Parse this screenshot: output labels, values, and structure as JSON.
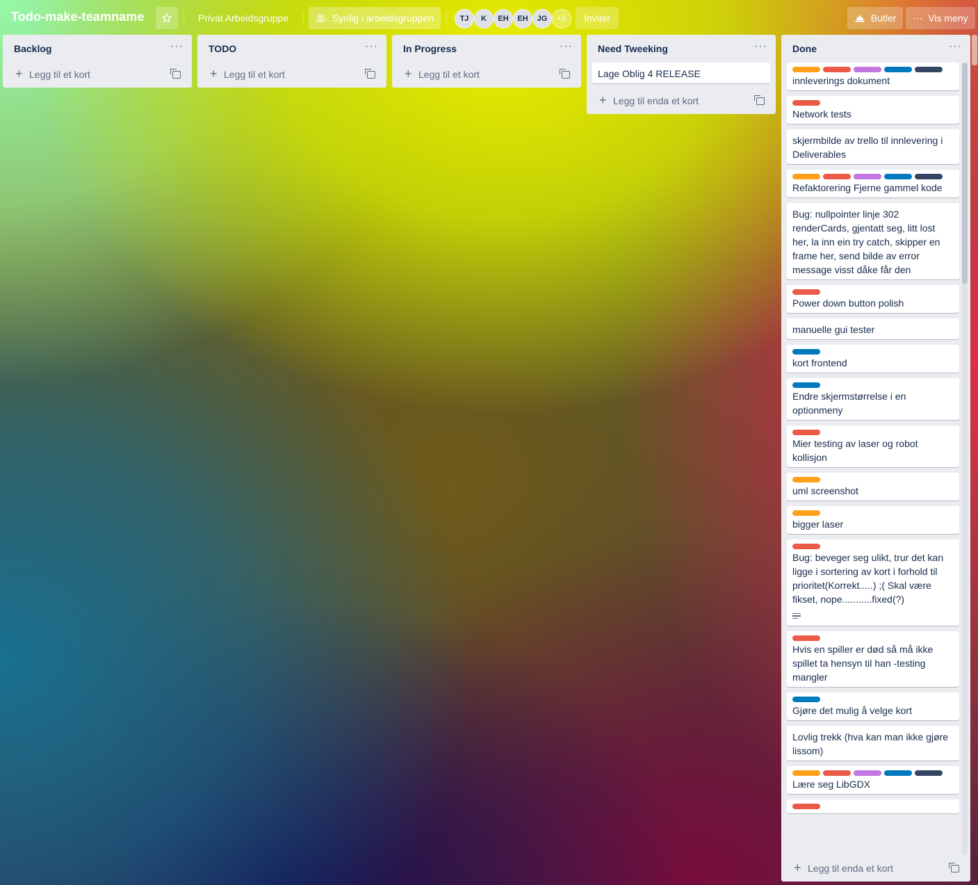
{
  "board": {
    "title": "Todo-make-teamname",
    "workspace": "Privat Arbeidsgruppe",
    "visibility": "Synlig i arbeidsgruppen",
    "members": [
      "TJ",
      "K",
      "EH",
      "EH",
      "JG"
    ],
    "more_members": "+2",
    "invite": "Inviter",
    "butler": "Butler",
    "show_menu": "Vis meny"
  },
  "lists": [
    {
      "title": "Backlog",
      "add_label": "Legg til et kort"
    },
    {
      "title": "TODO",
      "add_label": "Legg til et kort"
    },
    {
      "title": "In Progress",
      "add_label": "Legg til et kort"
    },
    {
      "title": "Need Tweeking",
      "add_label": "Legg til enda et kort",
      "cards": [
        {
          "text": "Lage Oblig 4 RELEASE"
        }
      ]
    },
    {
      "title": "Done",
      "add_label": "Legg til enda et kort",
      "cards": [
        {
          "labels": [
            "orange",
            "red",
            "purple",
            "blue",
            "navy"
          ],
          "text": "innleverings dokument"
        },
        {
          "labels": [
            "red"
          ],
          "text": "Network tests"
        },
        {
          "labels": [],
          "text": "skjermbilde av trello til innlevering i Deliverables"
        },
        {
          "labels": [
            "orange",
            "red",
            "purple",
            "blue",
            "navy"
          ],
          "text": "Refaktorering Fjerne gammel kode"
        },
        {
          "labels": [],
          "text": "Bug: nullpointer linje 302 renderCards, gjentatt seg, litt lost her, la inn ein try catch, skipper en frame her, send bilde av error message visst dåke får den"
        },
        {
          "labels": [
            "red"
          ],
          "text": "Power down button polish"
        },
        {
          "labels": [],
          "text": "manuelle gui tester"
        },
        {
          "labels": [
            "blue"
          ],
          "text": "kort frontend"
        },
        {
          "labels": [
            "blue"
          ],
          "text": "Endre skjermstørrelse i en optionmeny"
        },
        {
          "labels": [
            "red"
          ],
          "text": "Mier testing av laser og robot kollisjon"
        },
        {
          "labels": [
            "orange"
          ],
          "text": "uml screenshot"
        },
        {
          "labels": [
            "orange"
          ],
          "text": "bigger laser"
        },
        {
          "labels": [
            "red"
          ],
          "text": "Bug: beveger seg ulikt, trur det kan ligge i sortering av kort i forhold til prioritet(Korrekt.....) ;( Skal være fikset, nope...........fixed(?)",
          "has_description": true
        },
        {
          "labels": [
            "red"
          ],
          "text": "Hvis en spiller er død så må ikke spillet ta hensyn til han -testing mangler"
        },
        {
          "labels": [
            "blue"
          ],
          "text": "Gjøre det mulig å velge kort"
        },
        {
          "labels": [],
          "text": "Lovlig trekk (hva kan man ikke gjøre lissom)"
        },
        {
          "labels": [
            "orange",
            "red",
            "purple",
            "blue",
            "navy"
          ],
          "text": "Lære seg LibGDX"
        },
        {
          "labels": [
            "red"
          ],
          "text": ""
        }
      ]
    }
  ],
  "label_colors": {
    "orange": "#ff9f1a",
    "red": "#eb5a46",
    "purple": "#c377e0",
    "blue": "#0079bf",
    "navy": "#344563"
  }
}
